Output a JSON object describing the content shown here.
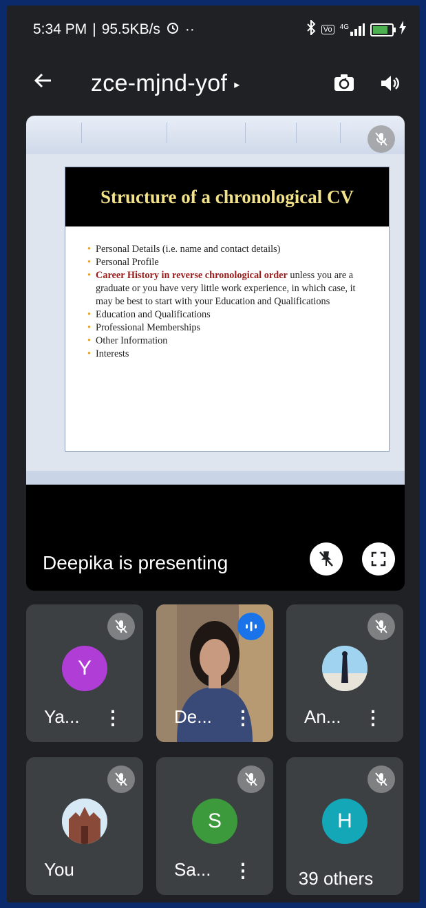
{
  "status_bar": {
    "time": "5:34 PM",
    "separator": "|",
    "network_speed": "95.5KB/s",
    "alarm_icon": "alarm-icon",
    "more": "··",
    "icons": [
      "bluetooth-icon",
      "volte-icon",
      "signal-icon",
      "battery-icon",
      "charging-icon"
    ],
    "volte_label": "Vo",
    "network_type": "4G"
  },
  "header": {
    "back_icon": "arrow-left-icon",
    "meeting_code": "zce-mjnd-yof",
    "chevron": "▸",
    "camera_switch_icon": "camera-switch-icon",
    "speaker_icon": "speaker-icon"
  },
  "presentation": {
    "slide_title": "Structure of a chronological CV",
    "bullets": [
      {
        "text": "Personal Details (i.e. name and contact details)"
      },
      {
        "text": "Personal Profile"
      },
      {
        "highlight": "Career History in reverse chronological order",
        "text": " unless you are a graduate or you have very little work experience, in which case, it may be best to start with your Education and Qualifications"
      },
      {
        "text": "Education and Qualifications"
      },
      {
        "text": "Professional Memberships"
      },
      {
        "text": "Other Information"
      },
      {
        "text": "Interests"
      }
    ],
    "presenting_label": "Deepika is presenting",
    "colors": {
      "title": "#f2e38a",
      "highlight": "#9b1b1b",
      "bullet": "#e8a020"
    }
  },
  "tiles": [
    {
      "name": "Ya...",
      "avatar_letter": "Y",
      "avatar_color": "#b03dd6",
      "muted": true
    },
    {
      "name": "De...",
      "speaking": true,
      "video": true
    },
    {
      "name": "An...",
      "avatar_photo": true,
      "muted": true
    },
    {
      "name": "You",
      "avatar_photo": true,
      "muted": true
    },
    {
      "name": "Sa...",
      "avatar_letter": "S",
      "avatar_color": "#3c9a3c",
      "muted": true
    },
    {
      "avatar_letter": "H",
      "avatar_color": "#13a7b8",
      "muted": true
    }
  ],
  "others_label": "39 others"
}
